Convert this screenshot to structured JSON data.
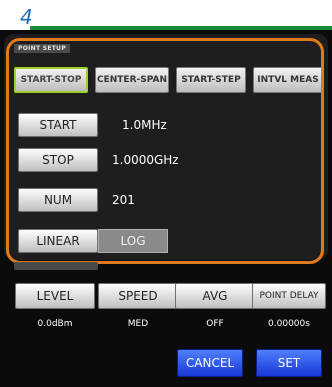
{
  "step": {
    "number": "4"
  },
  "point_setup": {
    "section_label": "POINT SETUP",
    "tabs": [
      {
        "label": "START-STOP",
        "active": true
      },
      {
        "label": "CENTER-SPAN",
        "active": false
      },
      {
        "label": "START-STEP",
        "active": false
      },
      {
        "label": "INTVL MEAS",
        "active": false
      }
    ],
    "rows": [
      {
        "label": "START",
        "value": "1.0MHz"
      },
      {
        "label": "STOP",
        "value": "1.0000GHz"
      },
      {
        "label": "NUM",
        "value": "201"
      }
    ],
    "sweep": {
      "linear_label": "LINEAR",
      "log_label": "LOG",
      "selected": "LOG"
    }
  },
  "measurement": {
    "buttons": [
      {
        "label": "LEVEL",
        "value": "0.0dBm"
      },
      {
        "label": "SPEED",
        "value": "MED"
      },
      {
        "label": "AVG",
        "value": "OFF"
      },
      {
        "label": "POINT DELAY",
        "value": "0.00000s"
      }
    ]
  },
  "footer": {
    "cancel_label": "CANCEL",
    "set_label": "SET"
  },
  "colors": {
    "highlight_frame": "#e07a1a",
    "active_tab_border": "#9fd12a",
    "action_button": "#1f4ef0",
    "step_number": "#1f6fb8"
  }
}
